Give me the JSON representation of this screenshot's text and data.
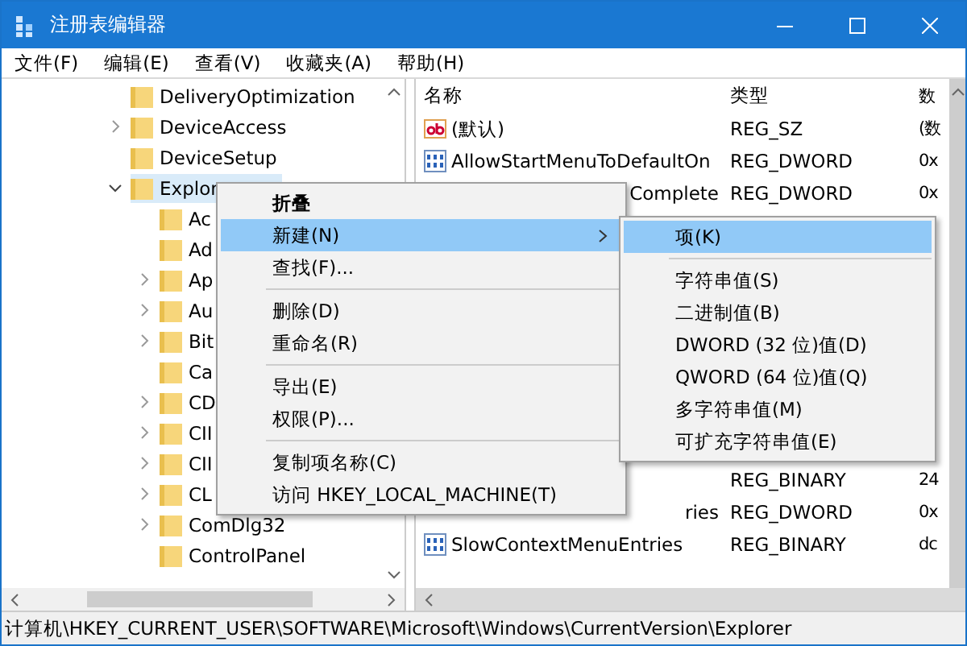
{
  "window": {
    "title": "注册表编辑器"
  },
  "menu_bar": [
    "文件(F)",
    "编辑(E)",
    "查看(V)",
    "收藏夹(A)",
    "帮助(H)"
  ],
  "tree": {
    "items": [
      {
        "label": "DeliveryOptimization",
        "selected": false
      },
      {
        "label": "DeviceAccess",
        "expanded": false,
        "selected": false
      },
      {
        "label": "DeviceSetup",
        "selected": false
      },
      {
        "label": "Explor",
        "expanded": true,
        "selected": true,
        "children": [
          {
            "label": "Ac",
            "selected": false
          },
          {
            "label": "Ad",
            "selected": false
          },
          {
            "label": "Ap",
            "expanded": false,
            "selected": false
          },
          {
            "label": "Au",
            "expanded": false,
            "selected": false
          },
          {
            "label": "Bit",
            "expanded": false,
            "selected": false
          },
          {
            "label": "Ca",
            "selected": false
          },
          {
            "label": "CD",
            "expanded": false,
            "selected": false
          },
          {
            "label": "CII",
            "expanded": false,
            "selected": false
          },
          {
            "label": "CII",
            "expanded": false,
            "selected": false
          },
          {
            "label": "CL",
            "expanded": false,
            "selected": false
          },
          {
            "label": "ComDlg32",
            "expanded": false,
            "selected": false
          },
          {
            "label": "ControlPanel",
            "selected": false
          }
        ]
      }
    ]
  },
  "values": {
    "columns": [
      "名称",
      "类型",
      "数"
    ],
    "rows": [
      {
        "kind": "string",
        "name": "(默认)",
        "type": "REG_SZ",
        "data": "(数"
      },
      {
        "kind": "binary",
        "name": "AllowStartMenuToDefaultOn",
        "type": "REG_DWORD",
        "data": "0x"
      },
      {
        "name": "Complete",
        "type": "REG_DWORD",
        "data": "0x"
      },
      {
        "type": "REG_BINARY",
        "data": "24"
      },
      {
        "name": "ries",
        "type": "REG_DWORD",
        "data": "0x"
      },
      {
        "kind": "binary",
        "name": "SlowContextMenuEntries",
        "type": "REG_BINARY",
        "data": "dc"
      }
    ]
  },
  "context_menu": {
    "items": [
      {
        "kind": "item",
        "label": "折叠",
        "default": true,
        "selected": false,
        "has_submenu": false
      },
      {
        "kind": "item",
        "label": "新建(N)",
        "default": false,
        "selected": true,
        "has_submenu": true
      },
      {
        "kind": "item",
        "label": "查找(F)...",
        "default": false,
        "selected": false,
        "has_submenu": false
      },
      {
        "kind": "separator"
      },
      {
        "kind": "item",
        "label": "删除(D)",
        "default": false,
        "selected": false,
        "has_submenu": false
      },
      {
        "kind": "item",
        "label": "重命名(R)",
        "default": false,
        "selected": false,
        "has_submenu": false
      },
      {
        "kind": "separator"
      },
      {
        "kind": "item",
        "label": "导出(E)",
        "default": false,
        "selected": false,
        "has_submenu": false
      },
      {
        "kind": "item",
        "label": "权限(P)...",
        "default": false,
        "selected": false,
        "has_submenu": false
      },
      {
        "kind": "separator"
      },
      {
        "kind": "item",
        "label": "复制项名称(C)",
        "default": false,
        "selected": false,
        "has_submenu": false
      },
      {
        "kind": "item",
        "label": "访问 HKEY_LOCAL_MACHINE(T)",
        "default": false,
        "selected": false,
        "has_submenu": false
      }
    ]
  },
  "submenu": {
    "items": [
      {
        "kind": "item",
        "label": "项(K)",
        "selected": true
      },
      {
        "kind": "separator"
      },
      {
        "kind": "item",
        "label": "字符串值(S)",
        "selected": false
      },
      {
        "kind": "item",
        "label": "二进制值(B)",
        "selected": false
      },
      {
        "kind": "item",
        "label": "DWORD (32 位)值(D)",
        "selected": false
      },
      {
        "kind": "item",
        "label": "QWORD (64 位)值(Q)",
        "selected": false
      },
      {
        "kind": "item",
        "label": "多字符串值(M)",
        "selected": false
      },
      {
        "kind": "item",
        "label": "可扩充字符串值(E)",
        "selected": false
      }
    ]
  },
  "status_bar": "计算机\\HKEY_CURRENT_USER\\SOFTWARE\\Microsoft\\Windows\\CurrentVersion\\Explorer"
}
